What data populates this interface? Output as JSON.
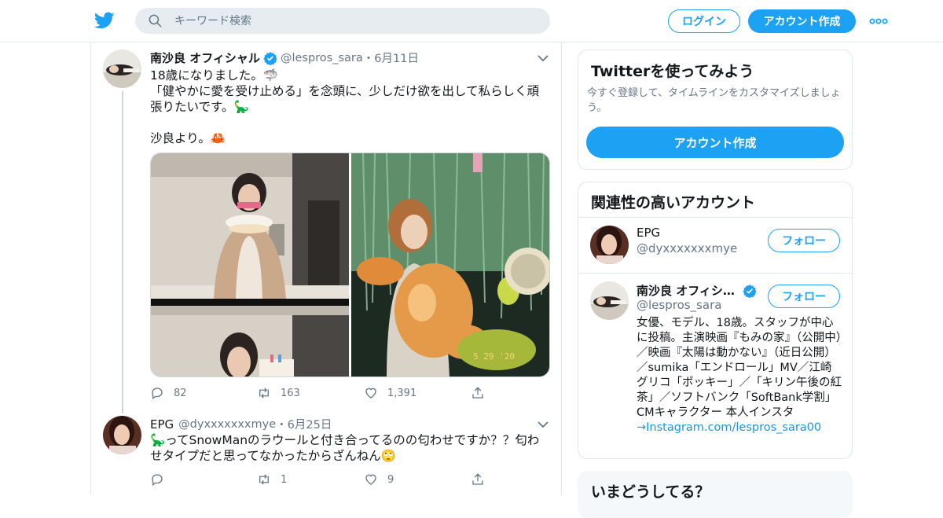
{
  "header": {
    "search_placeholder": "キーワード検索",
    "login_label": "ログイン",
    "signup_label": "アカウント作成"
  },
  "tweets": [
    {
      "name": "南沙良 オフィシャル",
      "handle": "@lespros_sara",
      "dot": "・",
      "date": "6月11日",
      "text_lines": [
        "18歳になりました。🦈",
        "「健やかに愛を受け止める」を念頭に、少しだけ欲を出して私らしく頑張りたいです。🦕",
        "",
        "沙良より。🦀"
      ],
      "stats": {
        "replies": "82",
        "retweets": "163",
        "likes": "1,391"
      }
    },
    {
      "name": "EPG",
      "handle": "@dyxxxxxxxmye",
      "dot": "・",
      "date": "6月25日",
      "text_lines": [
        "🦕ってSnowManのラウールと付き合ってるのの匂わせですか？？匂わせタイプだと思ってなかったからざんねん🙄"
      ],
      "stats": {
        "replies": "",
        "retweets": "1",
        "likes": "9"
      }
    }
  ],
  "sidebar": {
    "try_card": {
      "title": "Twitterを使ってみよう",
      "subtitle": "今すぐ登録して、タイムラインをカスタマイズしましょう。",
      "button": "アカウント作成"
    },
    "related": {
      "title": "関連性の高いアカウント",
      "follow_label": "フォロー",
      "accounts": [
        {
          "name": "EPG",
          "handle": "@dyxxxxxxxmye"
        },
        {
          "name": "南沙良 オフィシ…",
          "handle": "@lespros_sara",
          "bio": "女優、モデル、18歳。スタッフが中心に投稿。主演映画『もみの家』（公開中）／映画『太陽は動かない』（近日公開）／sumika「エンドロール」MV／江崎グリコ「ポッキー」／「キリン午後の紅茶」／ソフトバンク「SoftBank学割」CMキャラクター 本人インスタ",
          "bio_link": "→Instagram.com/lespros_sara00"
        }
      ]
    },
    "whats_happening": {
      "title": "いまどうしてる？"
    }
  },
  "colors": {
    "brand": "#1da1f2",
    "link": "#1b95e0",
    "secondary_text": "#657786",
    "border": "#e1e8ed"
  },
  "icons": [
    "twitter-bird-icon",
    "search-icon",
    "more-dots-icon",
    "verified-badge-icon",
    "chevron-down-icon",
    "reply-icon",
    "retweet-icon",
    "like-icon",
    "share-icon"
  ]
}
